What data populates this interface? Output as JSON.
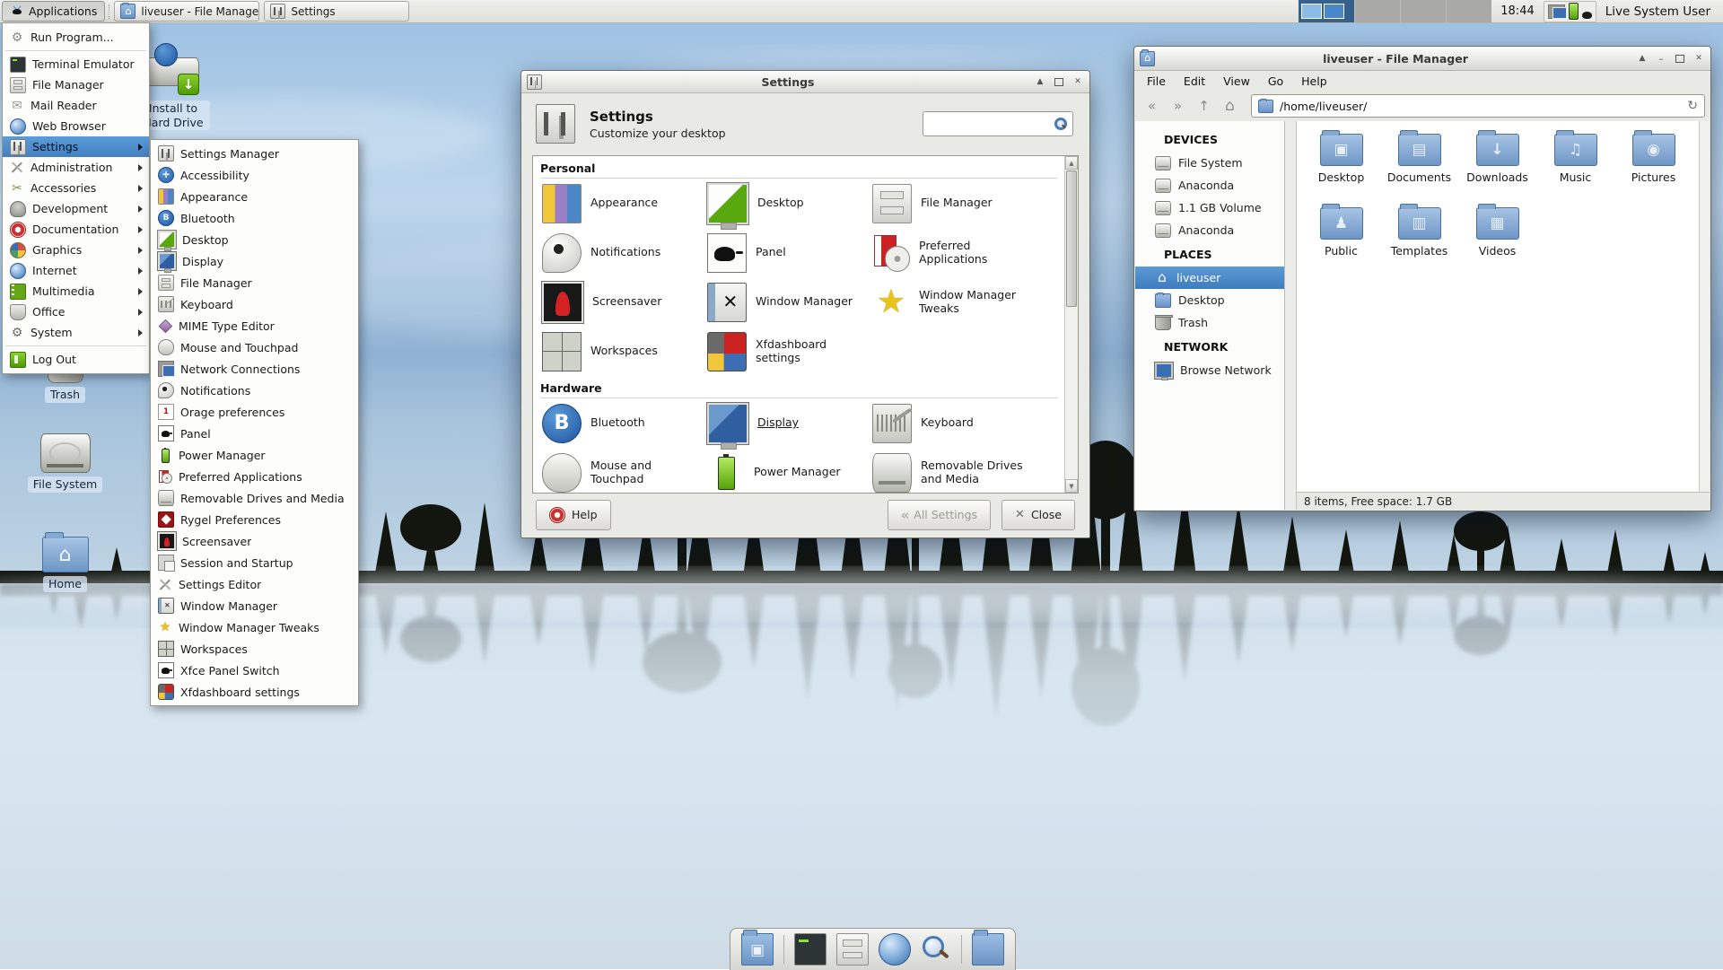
{
  "panel": {
    "applications": {
      "label": "Applications",
      "icon": "xfce-mouse"
    },
    "windows": [
      {
        "title": "liveuser - File Manager",
        "icon": "home-folder"
      },
      {
        "title": "Settings",
        "icon": "settings"
      }
    ],
    "pager_workspaces": 2,
    "clock": "18:44",
    "tray_icons": [
      "network",
      "battery",
      "mouse"
    ],
    "user_label": "Live System User"
  },
  "applications_menu": {
    "items": [
      {
        "label": "Run Program...",
        "icon": "run"
      },
      {
        "separator": true
      },
      {
        "label": "Terminal Emulator",
        "icon": "terminal"
      },
      {
        "label": "File Manager",
        "icon": "filecab"
      },
      {
        "label": "Mail Reader",
        "icon": "mail"
      },
      {
        "label": "Web Browser",
        "icon": "globe"
      },
      {
        "label": "Settings",
        "icon": "settings",
        "submenu": true,
        "selected": true
      },
      {
        "label": "Administration",
        "icon": "tools",
        "submenu": true
      },
      {
        "label": "Accessories",
        "icon": "scissors",
        "submenu": true
      },
      {
        "label": "Development",
        "icon": "devel",
        "submenu": true
      },
      {
        "label": "Documentation",
        "icon": "lifering",
        "submenu": true
      },
      {
        "label": "Graphics",
        "icon": "palette",
        "submenu": true
      },
      {
        "label": "Internet",
        "icon": "globe",
        "submenu": true
      },
      {
        "label": "Multimedia",
        "icon": "film",
        "submenu": true
      },
      {
        "label": "Office",
        "icon": "office",
        "submenu": true
      },
      {
        "label": "System",
        "icon": "sysgear",
        "submenu": true
      },
      {
        "separator": true
      },
      {
        "label": "Log Out",
        "icon": "logout"
      }
    ]
  },
  "settings_submenu": {
    "items": [
      {
        "label": "Settings Manager",
        "icon": "settings"
      },
      {
        "label": "Accessibility",
        "icon": "accessibility"
      },
      {
        "label": "Appearance",
        "icon": "swatches"
      },
      {
        "label": "Bluetooth",
        "icon": "bluetooth"
      },
      {
        "label": "Desktop",
        "icon": "desktopmon"
      },
      {
        "label": "Display",
        "icon": "display"
      },
      {
        "label": "File Manager",
        "icon": "filecab"
      },
      {
        "label": "Keyboard",
        "icon": "keyboard"
      },
      {
        "label": "MIME Type Editor",
        "icon": "mime"
      },
      {
        "label": "Mouse and Touchpad",
        "icon": "mousetp"
      },
      {
        "label": "Network Connections",
        "icon": "netconn"
      },
      {
        "label": "Notifications",
        "icon": "notif"
      },
      {
        "label": "Orage preferences",
        "icon": "orage"
      },
      {
        "label": "Panel",
        "icon": "panelmouse"
      },
      {
        "label": "Power Manager",
        "icon": "power"
      },
      {
        "label": "Preferred Applications",
        "icon": "prefapps"
      },
      {
        "label": "Removable Drives and Media",
        "icon": "removable"
      },
      {
        "label": "Rygel Preferences",
        "icon": "rygel"
      },
      {
        "label": "Screensaver",
        "icon": "screensaver"
      },
      {
        "label": "Session and Startup",
        "icon": "session"
      },
      {
        "label": "Settings Editor",
        "icon": "tools"
      },
      {
        "label": "Window Manager",
        "icon": "wm"
      },
      {
        "label": "Window Manager Tweaks",
        "icon": "wmtweaks"
      },
      {
        "label": "Workspaces",
        "icon": "workspaces"
      },
      {
        "label": "Xfce Panel Switch",
        "icon": "panelmouse"
      },
      {
        "label": "Xfdashboard settings",
        "icon": "xfdash"
      }
    ]
  },
  "settings_window": {
    "title": "Settings",
    "header_title": "Settings",
    "header_subtitle": "Customize your desktop",
    "search_value": "",
    "sections": [
      {
        "name": "Personal",
        "items": [
          {
            "label": "Appearance",
            "icon": "swatches"
          },
          {
            "label": "Desktop",
            "icon": "desktopmon"
          },
          {
            "label": "File Manager",
            "icon": "filecab"
          },
          {
            "label": "Notifications",
            "icon": "notif"
          },
          {
            "label": "Panel",
            "icon": "panelmouse"
          },
          {
            "label": "Preferred Applications",
            "icon": "prefapps"
          },
          {
            "label": "Screensaver",
            "icon": "screensaver"
          },
          {
            "label": "Window Manager",
            "icon": "wm"
          },
          {
            "label": "Window Manager Tweaks",
            "icon": "wmtweaks"
          },
          {
            "label": "Workspaces",
            "icon": "workspaces"
          },
          {
            "label": "Xfdashboard settings",
            "icon": "xfdash"
          }
        ]
      },
      {
        "name": "Hardware",
        "items": [
          {
            "label": "Bluetooth",
            "icon": "bluetooth"
          },
          {
            "label": "Display",
            "icon": "display",
            "underline": true
          },
          {
            "label": "Keyboard",
            "icon": "keyboard"
          },
          {
            "label": "Mouse and Touchpad",
            "icon": "mousetp"
          },
          {
            "label": "Power Manager",
            "icon": "power"
          },
          {
            "label": "Removable Drives and Media",
            "icon": "removable"
          }
        ]
      }
    ],
    "buttons": {
      "help": "Help",
      "all_settings": "All Settings",
      "close": "Close"
    }
  },
  "file_manager": {
    "title": "liveuser - File Manager",
    "menu_items": [
      "File",
      "Edit",
      "View",
      "Go",
      "Help"
    ],
    "path": "/home/liveuser/",
    "sidebar": [
      {
        "label": "DEVICES",
        "header": true
      },
      {
        "label": "File System",
        "icon": "drive"
      },
      {
        "label": "Anaconda",
        "icon": "drive"
      },
      {
        "label": "1.1 GB Volume",
        "icon": "drive"
      },
      {
        "label": "Anaconda",
        "icon": "drive"
      },
      {
        "label": "PLACES",
        "header": true
      },
      {
        "label": "liveuser",
        "icon": "home-white",
        "selected": true
      },
      {
        "label": "Desktop",
        "icon": "folder-small"
      },
      {
        "label": "Trash",
        "icon": "trashcan"
      },
      {
        "label": "NETWORK",
        "header": true
      },
      {
        "label": "Browse Network",
        "icon": "netbrowse"
      }
    ],
    "folders": [
      {
        "label": "Desktop",
        "glyph": "desktop-glyph"
      },
      {
        "label": "Documents",
        "glyph": "documents-glyph"
      },
      {
        "label": "Downloads",
        "glyph": "downloads-glyph"
      },
      {
        "label": "Music",
        "glyph": "music-glyph"
      },
      {
        "label": "Pictures",
        "glyph": "pictures-glyph"
      },
      {
        "label": "Public",
        "glyph": "public-glyph"
      },
      {
        "label": "Templates",
        "glyph": "templates-glyph"
      },
      {
        "label": "Videos",
        "glyph": "videos-glyph"
      }
    ],
    "statusbar": "8 items, Free space: 1.7 GB"
  },
  "desktop_icons": [
    {
      "label": "Install to Hard Drive",
      "icon": "install-drive"
    },
    {
      "label": "Trash",
      "icon": "trash-desktop"
    },
    {
      "label": "File System",
      "icon": "drive-big"
    },
    {
      "label": "Home",
      "icon": "home-big"
    }
  ],
  "dock": {
    "items": [
      {
        "icon": "desktop-folder"
      },
      {
        "separator": true
      },
      {
        "icon": "terminal"
      },
      {
        "icon": "filecab"
      },
      {
        "icon": "globe-cursor"
      },
      {
        "icon": "search"
      },
      {
        "separator": true
      },
      {
        "icon": "folder-plain"
      }
    ]
  }
}
